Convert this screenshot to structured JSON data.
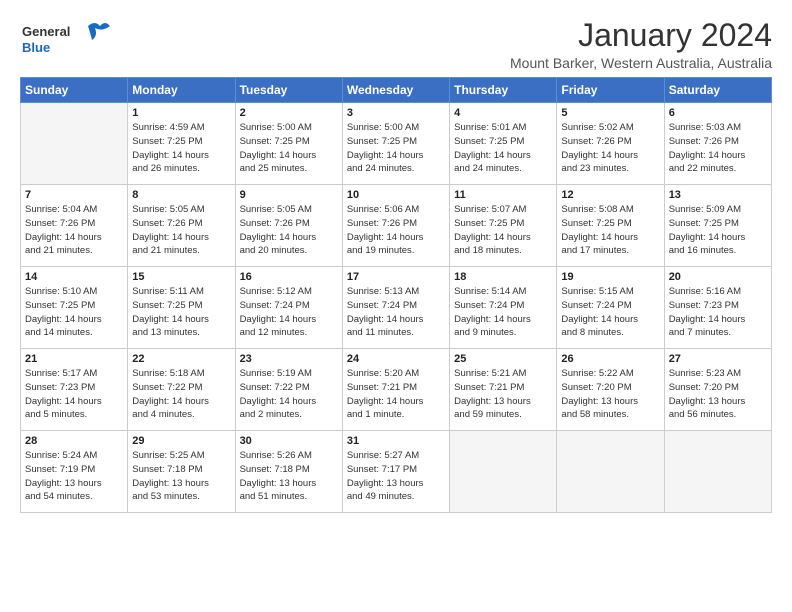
{
  "logo": {
    "line1": "General",
    "line2": "Blue"
  },
  "title": "January 2024",
  "location": "Mount Barker, Western Australia, Australia",
  "days_of_week": [
    "Sunday",
    "Monday",
    "Tuesday",
    "Wednesday",
    "Thursday",
    "Friday",
    "Saturday"
  ],
  "weeks": [
    [
      {
        "num": "",
        "info": ""
      },
      {
        "num": "1",
        "info": "Sunrise: 4:59 AM\nSunset: 7:25 PM\nDaylight: 14 hours\nand 26 minutes."
      },
      {
        "num": "2",
        "info": "Sunrise: 5:00 AM\nSunset: 7:25 PM\nDaylight: 14 hours\nand 25 minutes."
      },
      {
        "num": "3",
        "info": "Sunrise: 5:00 AM\nSunset: 7:25 PM\nDaylight: 14 hours\nand 24 minutes."
      },
      {
        "num": "4",
        "info": "Sunrise: 5:01 AM\nSunset: 7:25 PM\nDaylight: 14 hours\nand 24 minutes."
      },
      {
        "num": "5",
        "info": "Sunrise: 5:02 AM\nSunset: 7:26 PM\nDaylight: 14 hours\nand 23 minutes."
      },
      {
        "num": "6",
        "info": "Sunrise: 5:03 AM\nSunset: 7:26 PM\nDaylight: 14 hours\nand 22 minutes."
      }
    ],
    [
      {
        "num": "7",
        "info": "Sunrise: 5:04 AM\nSunset: 7:26 PM\nDaylight: 14 hours\nand 21 minutes."
      },
      {
        "num": "8",
        "info": "Sunrise: 5:05 AM\nSunset: 7:26 PM\nDaylight: 14 hours\nand 21 minutes."
      },
      {
        "num": "9",
        "info": "Sunrise: 5:05 AM\nSunset: 7:26 PM\nDaylight: 14 hours\nand 20 minutes."
      },
      {
        "num": "10",
        "info": "Sunrise: 5:06 AM\nSunset: 7:26 PM\nDaylight: 14 hours\nand 19 minutes."
      },
      {
        "num": "11",
        "info": "Sunrise: 5:07 AM\nSunset: 7:25 PM\nDaylight: 14 hours\nand 18 minutes."
      },
      {
        "num": "12",
        "info": "Sunrise: 5:08 AM\nSunset: 7:25 PM\nDaylight: 14 hours\nand 17 minutes."
      },
      {
        "num": "13",
        "info": "Sunrise: 5:09 AM\nSunset: 7:25 PM\nDaylight: 14 hours\nand 16 minutes."
      }
    ],
    [
      {
        "num": "14",
        "info": "Sunrise: 5:10 AM\nSunset: 7:25 PM\nDaylight: 14 hours\nand 14 minutes."
      },
      {
        "num": "15",
        "info": "Sunrise: 5:11 AM\nSunset: 7:25 PM\nDaylight: 14 hours\nand 13 minutes."
      },
      {
        "num": "16",
        "info": "Sunrise: 5:12 AM\nSunset: 7:24 PM\nDaylight: 14 hours\nand 12 minutes."
      },
      {
        "num": "17",
        "info": "Sunrise: 5:13 AM\nSunset: 7:24 PM\nDaylight: 14 hours\nand 11 minutes."
      },
      {
        "num": "18",
        "info": "Sunrise: 5:14 AM\nSunset: 7:24 PM\nDaylight: 14 hours\nand 9 minutes."
      },
      {
        "num": "19",
        "info": "Sunrise: 5:15 AM\nSunset: 7:24 PM\nDaylight: 14 hours\nand 8 minutes."
      },
      {
        "num": "20",
        "info": "Sunrise: 5:16 AM\nSunset: 7:23 PM\nDaylight: 14 hours\nand 7 minutes."
      }
    ],
    [
      {
        "num": "21",
        "info": "Sunrise: 5:17 AM\nSunset: 7:23 PM\nDaylight: 14 hours\nand 5 minutes."
      },
      {
        "num": "22",
        "info": "Sunrise: 5:18 AM\nSunset: 7:22 PM\nDaylight: 14 hours\nand 4 minutes."
      },
      {
        "num": "23",
        "info": "Sunrise: 5:19 AM\nSunset: 7:22 PM\nDaylight: 14 hours\nand 2 minutes."
      },
      {
        "num": "24",
        "info": "Sunrise: 5:20 AM\nSunset: 7:21 PM\nDaylight: 14 hours\nand 1 minute."
      },
      {
        "num": "25",
        "info": "Sunrise: 5:21 AM\nSunset: 7:21 PM\nDaylight: 13 hours\nand 59 minutes."
      },
      {
        "num": "26",
        "info": "Sunrise: 5:22 AM\nSunset: 7:20 PM\nDaylight: 13 hours\nand 58 minutes."
      },
      {
        "num": "27",
        "info": "Sunrise: 5:23 AM\nSunset: 7:20 PM\nDaylight: 13 hours\nand 56 minutes."
      }
    ],
    [
      {
        "num": "28",
        "info": "Sunrise: 5:24 AM\nSunset: 7:19 PM\nDaylight: 13 hours\nand 54 minutes."
      },
      {
        "num": "29",
        "info": "Sunrise: 5:25 AM\nSunset: 7:18 PM\nDaylight: 13 hours\nand 53 minutes."
      },
      {
        "num": "30",
        "info": "Sunrise: 5:26 AM\nSunset: 7:18 PM\nDaylight: 13 hours\nand 51 minutes."
      },
      {
        "num": "31",
        "info": "Sunrise: 5:27 AM\nSunset: 7:17 PM\nDaylight: 13 hours\nand 49 minutes."
      },
      {
        "num": "",
        "info": ""
      },
      {
        "num": "",
        "info": ""
      },
      {
        "num": "",
        "info": ""
      }
    ]
  ]
}
